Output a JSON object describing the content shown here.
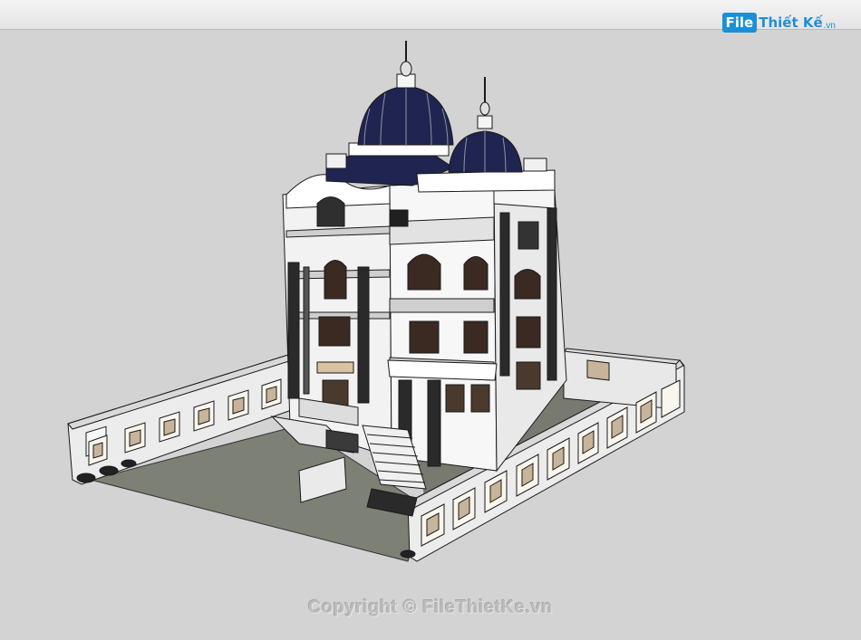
{
  "app": {
    "logo_badge": "File",
    "logo_text": "Thiết Kế",
    "logo_domain": ".vn"
  },
  "viewport": {
    "background_color": "#d3d3d3",
    "model_name_icon": "villa-3d-model"
  },
  "watermark": {
    "text": "Copyright © FileThietKe.vn"
  },
  "colors": {
    "dome": "#1f2550",
    "ground": "#7d8075",
    "wall": "#f2f2f2",
    "outline": "#1a1a1a",
    "panel": "#c8b49a"
  }
}
